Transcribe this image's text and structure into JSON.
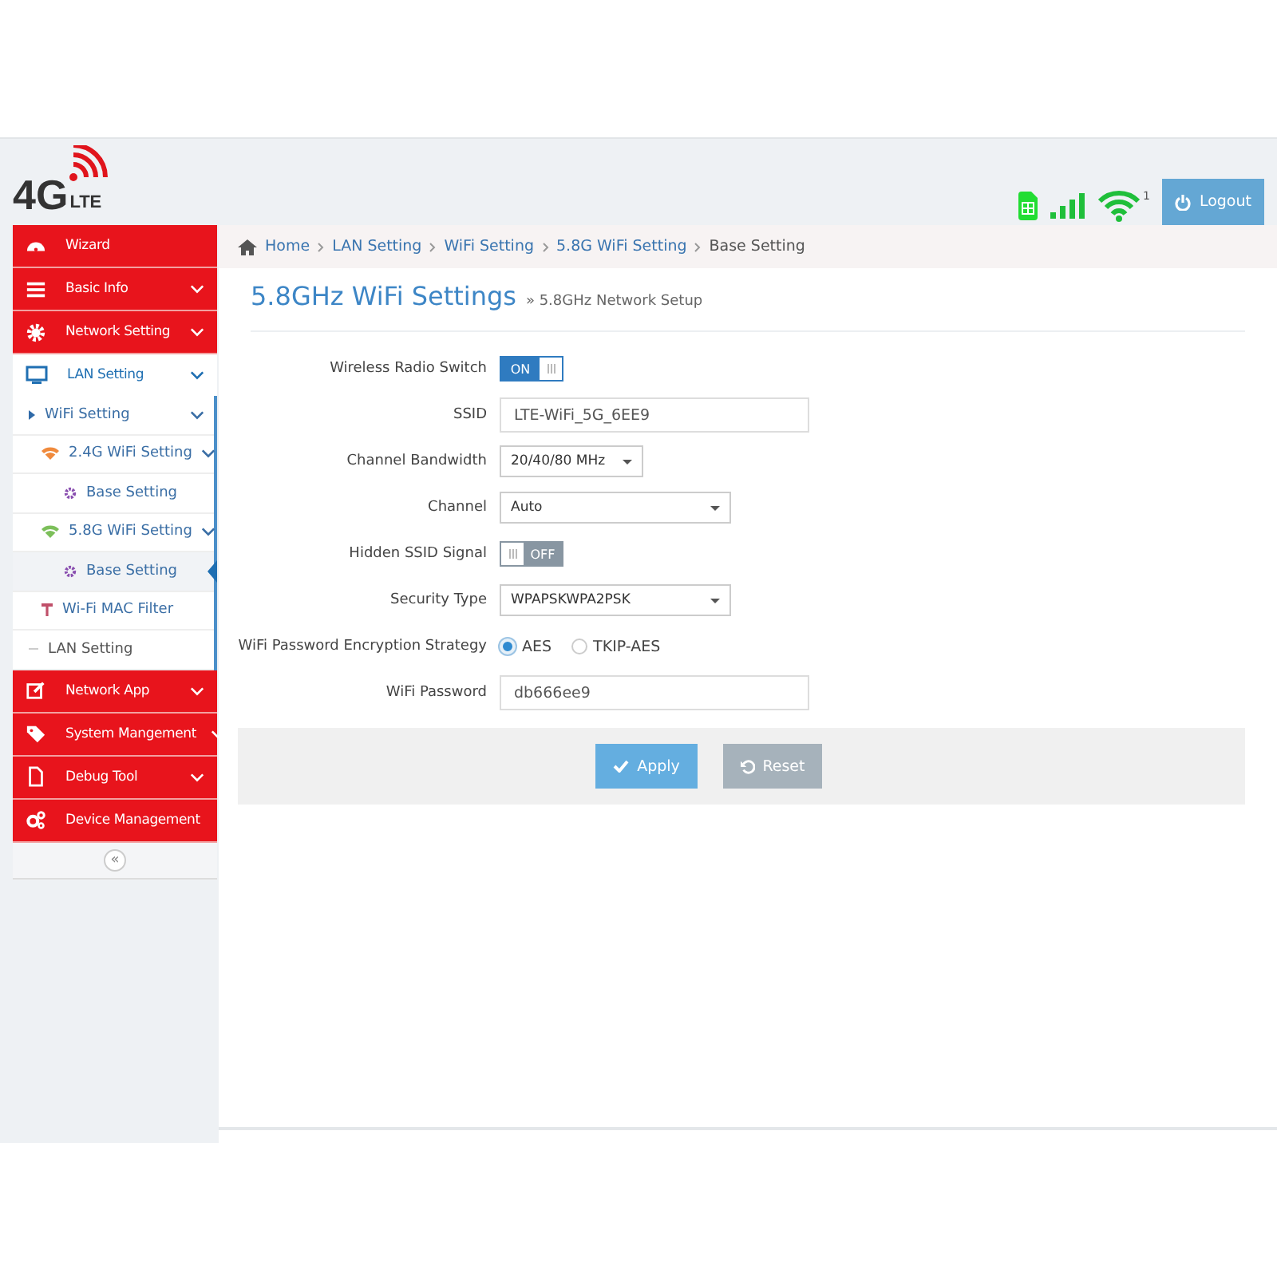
{
  "header": {
    "logo_main": "4G",
    "logo_sub": "LTE",
    "wifi_clients": "1",
    "logout": "Logout"
  },
  "sidebar": {
    "items": [
      {
        "label": "Wizard",
        "expandable": false,
        "expanded": false
      },
      {
        "label": "Basic Info",
        "expandable": true,
        "expanded": false
      },
      {
        "label": "Network Setting",
        "expandable": true,
        "expanded": false
      },
      {
        "label": "LAN Setting",
        "expandable": true,
        "expanded": true,
        "children": [
          {
            "label": "WiFi Setting",
            "kind": "branch",
            "expandable": true,
            "selected": false,
            "children": [
              {
                "label": "2.4G WiFi Setting",
                "kind": "wifi",
                "color": "#f08a3c",
                "expandable": true,
                "selected": false,
                "children": [
                  {
                    "label": "Base Setting",
                    "kind": "gear",
                    "expandable": false,
                    "selected": false
                  }
                ]
              },
              {
                "label": "5.8G WiFi Setting",
                "kind": "wifi",
                "color": "#7cbf5a",
                "expandable": true,
                "selected": false,
                "children": [
                  {
                    "label": "Base Setting",
                    "kind": "gear",
                    "expandable": false,
                    "selected": true
                  }
                ]
              },
              {
                "label": "Wi-Fi MAC Filter",
                "kind": "filter",
                "expandable": false,
                "selected": false
              }
            ]
          },
          {
            "label": "LAN Setting",
            "kind": "leaf",
            "expandable": false,
            "selected": false
          }
        ]
      },
      {
        "label": "Network App",
        "expandable": true,
        "expanded": false
      },
      {
        "label": "System Mangement",
        "expandable": true,
        "expanded": false
      },
      {
        "label": "Debug Tool",
        "expandable": true,
        "expanded": false
      },
      {
        "label": "Device Management",
        "expandable": false,
        "expanded": false
      }
    ],
    "collapse": "«"
  },
  "breadcrumb": [
    "Home",
    "LAN Setting",
    "WiFi Setting",
    "5.8G WiFi Setting",
    "Base Setting"
  ],
  "title": "5.8GHz WiFi Settings",
  "subtitle": "» 5.8GHz Network Setup",
  "form": [
    {
      "label": "Wireless Radio Switch",
      "kind": "toggle",
      "on": true,
      "text": "ON"
    },
    {
      "label": "SSID",
      "kind": "text",
      "value": "LTE-WiFi_5G_6EE9"
    },
    {
      "label": "Channel Bandwidth",
      "kind": "shortselect",
      "value": "20/40/80 MHz"
    },
    {
      "label": "Channel",
      "kind": "select",
      "value": "Auto"
    },
    {
      "label": "Hidden SSID Signal",
      "kind": "toggle",
      "on": false,
      "text": "OFF"
    },
    {
      "label": "Security Type",
      "kind": "select",
      "value": "WPAPSKWPA2PSK"
    },
    {
      "label": "WiFi Password Encryption Strategy",
      "kind": "radio",
      "options": [
        {
          "label": "AES",
          "selected": true
        },
        {
          "label": "TKIP-AES",
          "selected": false
        }
      ]
    },
    {
      "label": "WiFi Password",
      "kind": "text",
      "value": "db666ee9"
    }
  ],
  "buttons": [
    {
      "label": "Apply",
      "kind": "primary"
    },
    {
      "label": "Reset",
      "kind": "secondary"
    }
  ]
}
